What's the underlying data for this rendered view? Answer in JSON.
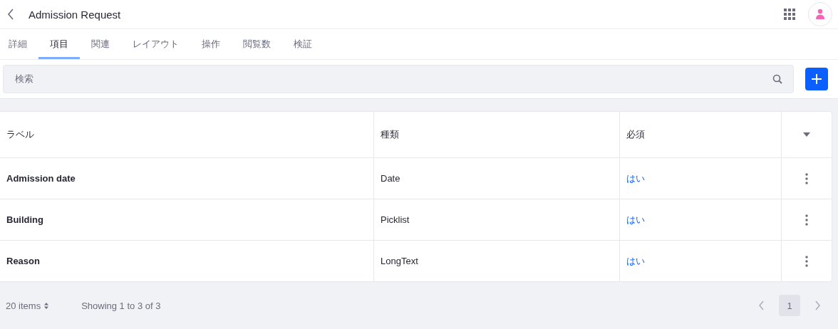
{
  "header": {
    "title": "Admission Request"
  },
  "tabs": [
    {
      "label": "詳細",
      "selected": false
    },
    {
      "label": "項目",
      "selected": true
    },
    {
      "label": "関連",
      "selected": false
    },
    {
      "label": "レイアウト",
      "selected": false
    },
    {
      "label": "操作",
      "selected": false
    },
    {
      "label": "閲覧数",
      "selected": false
    },
    {
      "label": "検証",
      "selected": false
    }
  ],
  "search": {
    "placeholder": "検索"
  },
  "table": {
    "columns": [
      "ラベル",
      "種類",
      "必須"
    ],
    "rows": [
      {
        "label": "Admission date",
        "type": "Date",
        "required": "はい"
      },
      {
        "label": "Building",
        "type": "Picklist",
        "required": "はい"
      },
      {
        "label": "Reason",
        "type": "LongText",
        "required": "はい"
      }
    ]
  },
  "footer": {
    "page_size": "20 items",
    "summary": "Showing 1 to 3 of 3",
    "pages": [
      {
        "label": "1",
        "selected": true
      }
    ]
  }
}
